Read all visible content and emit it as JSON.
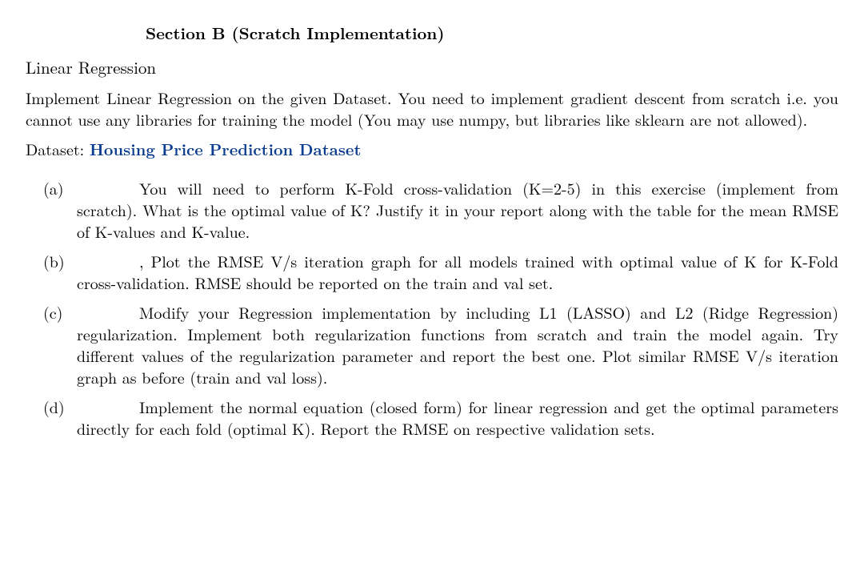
{
  "section_title": "Section B (Scratch Implementation)",
  "subtitle": "Linear Regression",
  "intro": "Implement Linear Regression on the given Dataset. You need to implement gradient descent from scratch i.e. you cannot use any libraries for training the model (You may use numpy, but libraries like sklearn are not allowed).",
  "dataset_label": "Dataset: ",
  "dataset_link_text": "Housing Price Prediction Dataset",
  "items": {
    "a": {
      "marker": "(a)",
      "text": "You will need to perform K-Fold cross-validation (K=2-5) in this exercise (implement from scratch). What is the optimal value of K? Justify it in your report along with the table for the mean RMSE of K-values and K-value."
    },
    "b": {
      "marker": "(b)",
      "lead": ", ",
      "text": "Plot the RMSE V/s iteration graph for all models trained with optimal value of K for K-Fold cross-validation. RMSE should be reported on the train and val set."
    },
    "c": {
      "marker": "(c)",
      "text": "Modify your Regression implementation by including L1 (LASSO) and L2 (Ridge Regression) regularization. Implement both regularization functions from scratch and train the model again. Try different values of the regularization pa­rameter and report the best one. Plot similar RMSE V/s iteration graph as before (train and val loss)."
    },
    "d": {
      "marker": "(d)",
      "text": "Implement the normal equation (closed form) for linear regression and get the optimal parameters directly for each fold (optimal K). Report the RMSE on respective validation sets."
    }
  }
}
